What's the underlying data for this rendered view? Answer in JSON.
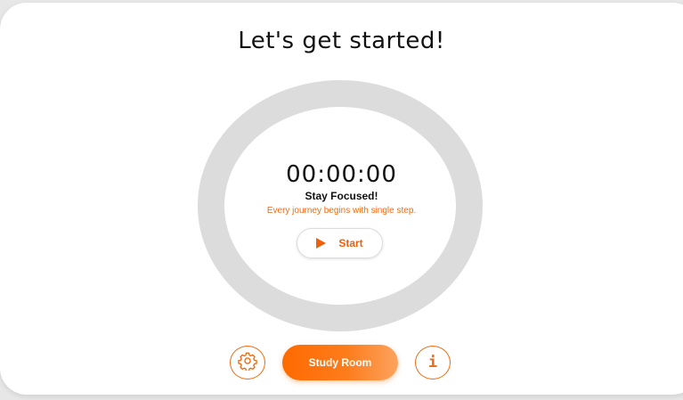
{
  "header": {
    "title": "Let's get started!"
  },
  "timer": {
    "time": "00:00:00",
    "status": "Stay Focused!",
    "tagline": "Every journey begins with single step.",
    "start_label": "Start",
    "start_icon": "play-icon"
  },
  "actions": {
    "settings_icon": "gear-icon",
    "study_room_label": "Study Room",
    "info_icon": "info-icon",
    "info_glyph": "i"
  },
  "colors": {
    "accent": "#f26a0f",
    "ring": "#dcdcdc",
    "background": "#ffffff"
  }
}
